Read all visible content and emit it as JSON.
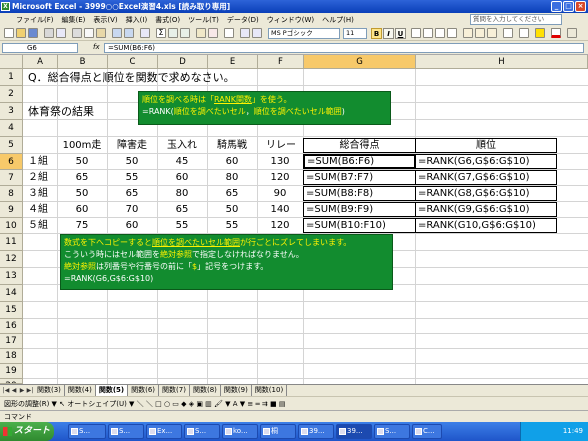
{
  "window": {
    "title": "Microsoft Excel - 3999○○Excel演習4.xls [読み取り専用]",
    "app_icon": "X"
  },
  "menu": {
    "items": [
      "ファイル(F)",
      "編集(E)",
      "表示(V)",
      "挿入(I)",
      "書式(O)",
      "ツール(T)",
      "データ(D)",
      "ウィンドウ(W)",
      "ヘルプ(H)"
    ],
    "help_placeholder": "質問を入力してください"
  },
  "toolbar": {
    "font_name": "MS Pゴシック",
    "font_size": "11",
    "bold": "B",
    "italic": "I",
    "underline": "U",
    "zoom": ""
  },
  "formula_bar": {
    "name_box": "G6",
    "fx": "fx",
    "formula": "=SUM(B6:F6)"
  },
  "grid": {
    "columns": [
      "A",
      "B",
      "C",
      "D",
      "E",
      "F",
      "G",
      "H"
    ],
    "rows": [
      "1",
      "2",
      "3",
      "4",
      "5",
      "6",
      "7",
      "8",
      "9",
      "10",
      "11",
      "12",
      "13",
      "14",
      "15",
      "16",
      "17",
      "18",
      "19",
      "20"
    ],
    "title": "Q．総合得点と順位を関数で求めなさい。",
    "subtitle": "体育祭の結果",
    "headers": [
      "100m走",
      "障害走",
      "玉入れ",
      "騎馬戦",
      "リレー",
      "総合得点",
      "順位"
    ],
    "records": [
      {
        "team": "１組",
        "scores": [
          "50",
          "50",
          "45",
          "60",
          "130"
        ],
        "total": "=SUM(B6:F6)",
        "rank": "=RANK(G6,G$6:G$10)"
      },
      {
        "team": "２組",
        "scores": [
          "65",
          "55",
          "60",
          "80",
          "120"
        ],
        "total": "=SUM(B7:F7)",
        "rank": "=RANK(G7,G$6:G$10)"
      },
      {
        "team": "３組",
        "scores": [
          "50",
          "65",
          "80",
          "65",
          "90"
        ],
        "total": "=SUM(B8:F8)",
        "rank": "=RANK(G8,G$6:G$10)"
      },
      {
        "team": "４組",
        "scores": [
          "60",
          "70",
          "65",
          "50",
          "140"
        ],
        "total": "=SUM(B9:F9)",
        "rank": "=RANK(G9,G$6:G$10)"
      },
      {
        "team": "５組",
        "scores": [
          "75",
          "60",
          "55",
          "55",
          "120"
        ],
        "total": "=SUM(B10:F10)",
        "rank": "=RANK(G10,G$6:G$10)"
      }
    ]
  },
  "callout1": {
    "line1_a": "順位を調べる時は「",
    "line1_b": "RANK関数",
    "line1_c": "」を使う。",
    "line2_a": "=RANK(",
    "line2_b": "順位を調べたいセル",
    "line2_c": "，",
    "line2_d": "順位を調べたいセル範囲",
    "line2_e": ")"
  },
  "callout2": {
    "line1_a": "数式を下へコピーすると",
    "line1_b": "順位を調べたいセル範囲",
    "line1_c": "が行ごとにズレてしまいます。",
    "line2_a": "こういう時にはセル範囲を",
    "line2_b": "絶対参照",
    "line2_c": "で指定しなければなりません。",
    "line3_a": "絶対参照",
    "line3_b": "は列番号や行番号の前に「",
    "line3_c": "$",
    "line3_d": "」記号をつけます。",
    "line4": "=RANK(G6,G$6:G$10)"
  },
  "sheets": {
    "tabs": [
      "関数(3)",
      "関数(4)",
      "関数(5)",
      "関数(6)",
      "関数(7)",
      "関数(8)",
      "関数(9)",
      "関数(10)"
    ],
    "active_index": 2
  },
  "drawbar": {
    "label": "図形の調整(R) ▼  ↖  オートシェイプ(U) ▼  ＼ ＼ □ ○ ▭ ◆ ◈ ▣ ▥  🖌 ▼ A ▼ ≡ ═ ⇉ ■ ▤"
  },
  "status": {
    "text": "コマンド"
  },
  "taskbar": {
    "start": "スタート",
    "tasks": [
      "S...",
      "S...",
      "Ex...",
      "S...",
      "ko...",
      "桐",
      "39...",
      "39...",
      "S...",
      "C..."
    ],
    "active_task": 7,
    "clock": "11:49"
  }
}
